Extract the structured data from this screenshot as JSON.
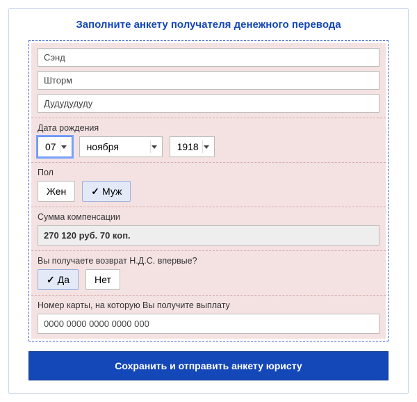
{
  "title": "Заполните анкету получателя денежного перевода",
  "inputs": {
    "last_name": "Сэнд",
    "first_name": "Шторм",
    "patronymic": "Дудудудуду"
  },
  "dob": {
    "label": "Дата рождения",
    "day": "07",
    "month": "ноября",
    "year": "1918"
  },
  "gender": {
    "label": "Пол",
    "female": "Жен",
    "male": "Муж",
    "selected": "male"
  },
  "compensation": {
    "label": "Сумма компенсации",
    "value": "270 120 руб. 70 коп."
  },
  "first_time": {
    "label": "Вы получаете возврат Н.Д.С. впервые?",
    "yes": "Да",
    "no": "Нет",
    "selected": "yes"
  },
  "card": {
    "label": "Номер карты, на которую Вы получите выплату",
    "value": "0000 0000 0000 0000 000"
  },
  "submit": "Сохранить и отправить анкету юристу"
}
